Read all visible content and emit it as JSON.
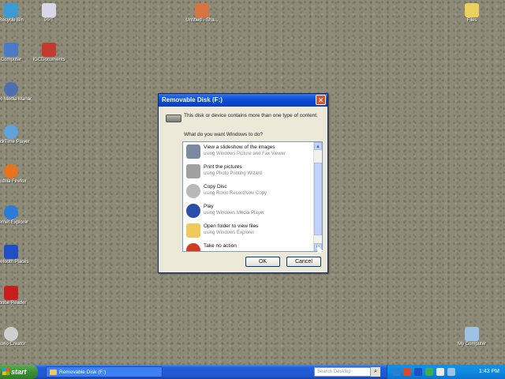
{
  "desktop": {
    "icons": [
      {
        "label": "Recycle Bin",
        "icon": "recycle-bin-icon",
        "color": "#3a9bd5"
      },
      {
        "label": "PPT",
        "icon": "document-icon",
        "color": "#d8d8e8"
      },
      {
        "label": "Untitled - Sha...",
        "icon": "powerpoint-icon",
        "color": "#d8743f"
      },
      {
        "label": "Files",
        "icon": "folder-icon",
        "color": "#e9d15b"
      },
      {
        "label": "Computer",
        "icon": "computer-icon",
        "color": "#4a7bc8"
      },
      {
        "label": "IGCDocuments",
        "icon": "pdf-icon",
        "color": "#c43a2e"
      },
      {
        "label": "Roxio Media Manager",
        "icon": "roxio-icon",
        "color": "#4c6fb0"
      },
      {
        "label": "QuickTime Player",
        "icon": "quicktime-icon",
        "color": "#5fa2dd"
      },
      {
        "label": "Mozilla Firefox",
        "icon": "firefox-icon",
        "color": "#e7731c"
      },
      {
        "label": "Internet Explorer",
        "icon": "ie-icon",
        "color": "#2b7bd8"
      },
      {
        "label": "Bluetooth Places",
        "icon": "bluetooth-icon",
        "color": "#1f4fc4"
      },
      {
        "label": "Adobe Reader",
        "icon": "adobe-reader-icon",
        "color": "#c81e1e"
      },
      {
        "label": "Roxio Creator",
        "icon": "disc-icon",
        "color": "#cfcfcf"
      },
      {
        "label": "My Computer",
        "icon": "my-computer-icon",
        "color": "#9ec1e6"
      }
    ]
  },
  "dialog": {
    "title": "Removable Disk (F:)",
    "close_glyph": "✕",
    "message": "This disk or device contains more than one type of content.",
    "question": "What do you want Windows to do?",
    "options": [
      {
        "title": "View a slideshow of the images",
        "subtitle": "using Windows Picture and Fax Viewer",
        "icon": "slideshow-icon",
        "color": "#7a8aa0"
      },
      {
        "title": "Print the pictures",
        "subtitle": "using Photo Printing Wizard",
        "icon": "printer-icon",
        "color": "#a0a0a0"
      },
      {
        "title": "Copy Disc",
        "subtitle": "using Roxio RecordNow Copy",
        "icon": "disc-copy-icon",
        "color": "#b8b8b8"
      },
      {
        "title": "Play",
        "subtitle": "using Windows Media Player",
        "icon": "media-player-icon",
        "color": "#2a4fa8"
      },
      {
        "title": "Open folder to view files",
        "subtitle": "using Windows Explorer",
        "icon": "folder-icon",
        "color": "#f0c95a"
      },
      {
        "title": "Take no action",
        "subtitle": "",
        "icon": "no-action-icon",
        "color": "#d23b20"
      }
    ],
    "ok_label": "OK",
    "cancel_label": "Cancel"
  },
  "taskbar": {
    "start_label": "start",
    "task_label": "Removable Disk (F:)",
    "search_placeholder": "Search Desktop",
    "search_glyph": "⌕",
    "tray_icons": [
      {
        "icon": "network-icon",
        "color": "#2a7fd4"
      },
      {
        "icon": "security-icon",
        "color": "#d84a2a"
      },
      {
        "icon": "bluetooth-icon",
        "color": "#1f4fc4"
      },
      {
        "icon": "sync-icon",
        "color": "#3bb04a"
      },
      {
        "icon": "volume-icon",
        "color": "#e9e9e9"
      },
      {
        "icon": "display-icon",
        "color": "#9ec1e6"
      }
    ],
    "clock": "1:43 PM"
  }
}
